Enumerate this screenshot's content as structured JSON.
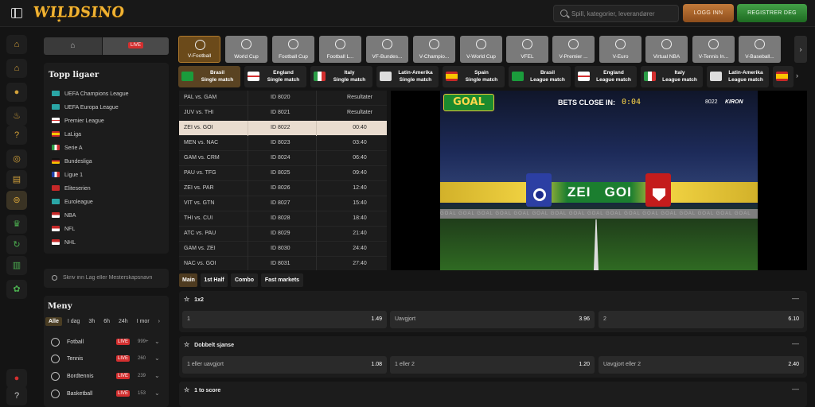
{
  "header": {
    "logo": "WILDSINO",
    "search_placeholder": "Spill, kategorier, leverandører",
    "login": "LOGG INN",
    "register": "REGISTRER DEG"
  },
  "left": {
    "live_badge": "LIVE",
    "top_leagues_title": "Topp ligaer",
    "leagues": [
      "UEFA Champions League",
      "UEFA Europa League",
      "Premier League",
      "LaLiga",
      "Serie A",
      "Bundesliga",
      "Ligue 1",
      "Eliteserien",
      "Euroleague",
      "NBA",
      "NFL",
      "NHL"
    ],
    "search_placeholder": "Skriv inn Lag eller Mesterskapsnavn",
    "menu_title": "Meny",
    "filters": [
      "Alle",
      "I dag",
      "3h",
      "6h",
      "24h",
      "I mor"
    ],
    "sports": [
      {
        "name": "Fotball",
        "live": "LIVE",
        "count": "999+"
      },
      {
        "name": "Tennis",
        "live": "LIVE",
        "count": "260"
      },
      {
        "name": "Bordtennis",
        "live": "LIVE",
        "count": "239"
      },
      {
        "name": "Basketball",
        "live": "LIVE",
        "count": "153"
      }
    ]
  },
  "games": [
    "V-Football",
    "World Cup",
    "Football Cup",
    "Football L...",
    "VF-Bundes...",
    "V-Champio...",
    "V-World Cup",
    "VFEL",
    "V-Premier ...",
    "V-Euro",
    "Virtual NBA",
    "V-Tennis In...",
    "V-Baseball..."
  ],
  "subtabs": [
    {
      "l1": "Brasil",
      "l2": "Single match",
      "flag": "#1b9c3c"
    },
    {
      "l1": "England",
      "l2": "Single match",
      "flag": "#ffffff"
    },
    {
      "l1": "Italy",
      "l2": "Single match",
      "flag": "#2a9c46"
    },
    {
      "l1": "Latin-Amerika",
      "l2": "Single match",
      "flag": "#ffffff"
    },
    {
      "l1": "Spain",
      "l2": "Single match",
      "flag": "#e0b21c"
    },
    {
      "l1": "Brasil",
      "l2": "League match",
      "flag": "#1b9c3c"
    },
    {
      "l1": "England",
      "l2": "League match",
      "flag": "#ffffff"
    },
    {
      "l1": "Italy",
      "l2": "League match",
      "flag": "#2a9c46"
    },
    {
      "l1": "Latin-Amerika",
      "l2": "League match",
      "flag": "#ffffff"
    }
  ],
  "matches": [
    {
      "teams": "PAL vs. GAM",
      "id": "ID 8020",
      "status": "Resultater"
    },
    {
      "teams": "JUV vs. THI",
      "id": "ID 8021",
      "status": "Resultater"
    },
    {
      "teams": "ZEI vs. GOI",
      "id": "ID 8022",
      "status": "00:40"
    },
    {
      "teams": "MEN vs. NAC",
      "id": "ID 8023",
      "status": "03:40"
    },
    {
      "teams": "GAM vs. CRM",
      "id": "ID 8024",
      "status": "06:40"
    },
    {
      "teams": "PAU vs. TFG",
      "id": "ID 8025",
      "status": "09:40"
    },
    {
      "teams": "ZEI vs. PAR",
      "id": "ID 8026",
      "status": "12:40"
    },
    {
      "teams": "VIT vs. GTN",
      "id": "ID 8027",
      "status": "15:40"
    },
    {
      "teams": "THI vs. CUI",
      "id": "ID 8028",
      "status": "18:40"
    },
    {
      "teams": "ATC vs. PAU",
      "id": "ID 8029",
      "status": "21:40"
    },
    {
      "teams": "GAM vs. ZEI",
      "id": "ID 8030",
      "status": "24:40"
    },
    {
      "teams": "NAC vs. GOI",
      "id": "ID 8031",
      "status": "27:40"
    }
  ],
  "video": {
    "logo": "GOAL",
    "bets_close": "BETS CLOSE IN:",
    "timer": "0:04",
    "match_id": "8022",
    "brand": "KIRON",
    "home": "ZEI",
    "away": "GOI",
    "adboard": "GOAL  GOAL  GOAL  GOAL  GOAL  GOAL  GOAL  GOAL  GOAL  GOAL  GOAL  GOAL  GOAL  GOAL  GOAL  GOAL  GOAL"
  },
  "market_tabs": [
    "Main",
    "1st Half",
    "Combo",
    "Fast markets"
  ],
  "markets": [
    {
      "title": "1x2",
      "odds": [
        {
          "name": "1",
          "value": "1.49"
        },
        {
          "name": "Uavgjort",
          "value": "3.96"
        },
        {
          "name": "2",
          "value": "6.10"
        }
      ]
    },
    {
      "title": "Dobbelt sjanse",
      "odds": [
        {
          "name": "1 eller uavgjort",
          "value": "1.08"
        },
        {
          "name": "1 eller 2",
          "value": "1.20"
        },
        {
          "name": "Uavgjort eller 2",
          "value": "2.40"
        }
      ]
    },
    {
      "title": "1 to score",
      "odds": []
    }
  ]
}
